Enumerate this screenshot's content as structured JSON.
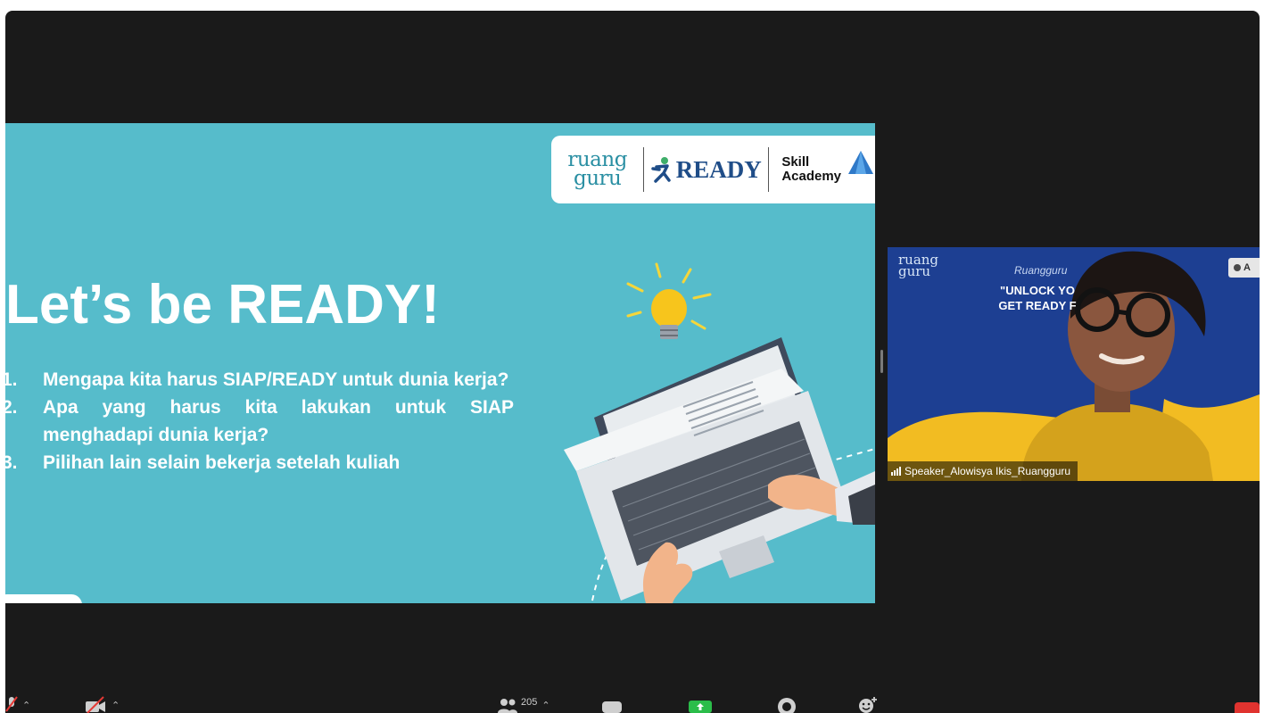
{
  "slide": {
    "logos": {
      "ruangguru_line1": "ruang",
      "ruangguru_line2": "guru",
      "ready": "READY",
      "skill_line1": "Skill",
      "skill_line2": "Academy"
    },
    "title": "Let’s be READY!",
    "items": [
      {
        "num": "1.",
        "text": "Mengapa kita harus SIAP/READY untuk dunia kerja?"
      },
      {
        "num": "2.",
        "text": "Apa yang harus kita lakukan untuk SIAP menghadapi dunia kerja?"
      },
      {
        "num": "3.",
        "text": "Pilihan lain selain bekerja setelah kuliah"
      }
    ]
  },
  "video": {
    "logo_line1": "ruang",
    "logo_line2": "guru",
    "brand": "Ruangguru",
    "banner_line1": "\"UNLOCK YO",
    "banner_line2": "GET READY F",
    "badge": "A",
    "speaker_name": "Speaker_Alowisya Ikis_Ruangguru"
  },
  "toolbar": {
    "participants_count": "205",
    "icons": [
      "mic-muted-icon",
      "video-off-icon",
      "participants-icon",
      "chat-icon",
      "share-screen-icon",
      "record-icon",
      "reactions-icon"
    ]
  },
  "colors": {
    "slide_background": "#56bccb",
    "video_background": "#1d3f92",
    "share_green": "#2bbd4a",
    "window_background": "#1a1a1a"
  }
}
